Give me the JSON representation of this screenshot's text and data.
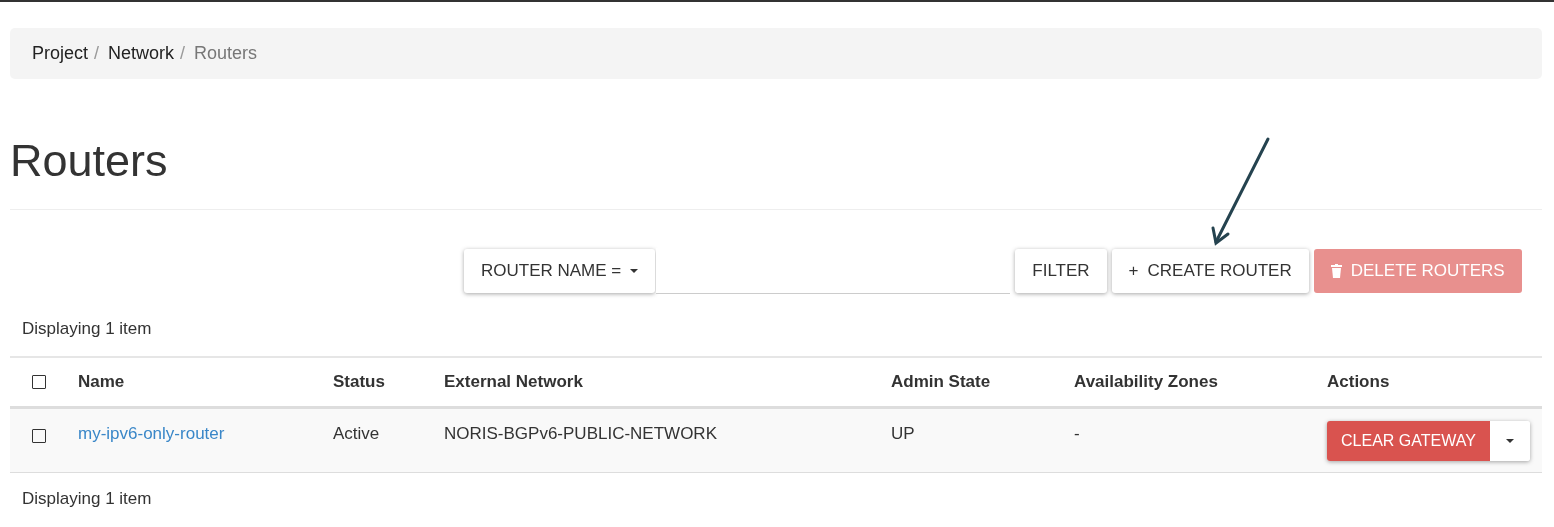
{
  "breadcrumb": [
    {
      "label": "Project",
      "current": false,
      "separator": "/"
    },
    {
      "label": "Network",
      "current": false,
      "separator": "/"
    },
    {
      "label": "Routers",
      "current": true
    }
  ],
  "page_title": "Routers",
  "toolbar": {
    "filter_field": {
      "label": "ROUTER NAME ="
    },
    "filter_button": "FILTER",
    "create_button": {
      "icon": "+",
      "label": "CREATE ROUTER",
      "disabled": false
    },
    "delete_button": {
      "label": "DELETE ROUTERS",
      "disabled": true
    }
  },
  "summary_top": "Displaying 1 item",
  "table": {
    "columns": [
      "Name",
      "Status",
      "External Network",
      "Admin State",
      "Availability Zones",
      "Actions"
    ],
    "header_checkbox": {
      "checked": false
    },
    "rows": [
      {
        "checked": false,
        "name": "my-ipv6-only-router",
        "status": "Active",
        "external_network": "NORIS-BGPv6-PUBLIC-NETWORK",
        "admin_state": "UP",
        "availability_zones": "-",
        "action": "CLEAR GATEWAY"
      }
    ]
  },
  "summary_bottom": "Displaying 1 item"
}
